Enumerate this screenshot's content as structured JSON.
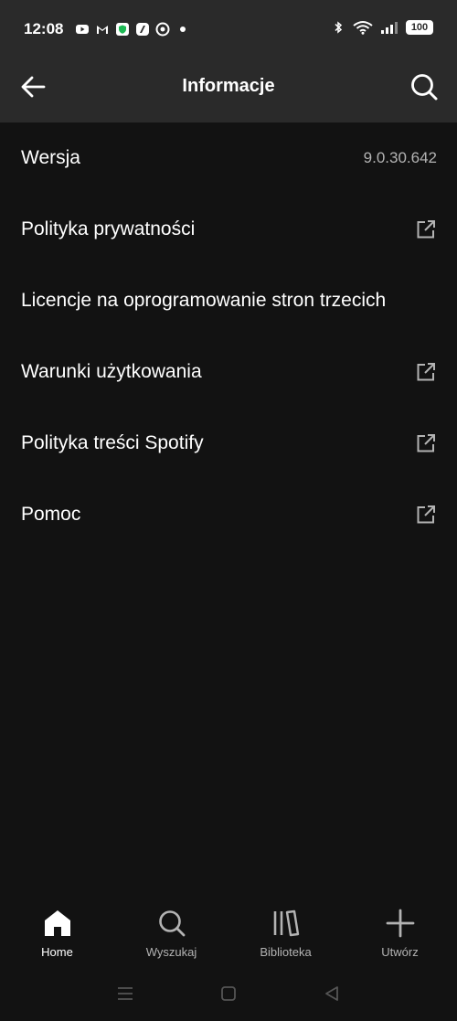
{
  "status_bar": {
    "time": "12:08",
    "battery": "100",
    "left_icons": [
      "youtube-icon",
      "gmail-icon",
      "vpn-shield-icon",
      "app-icon",
      "chrome-icon",
      "dot-icon"
    ],
    "right_icons": [
      "bluetooth-icon",
      "wifi-icon",
      "signal-icon",
      "battery-icon"
    ]
  },
  "header": {
    "title": "Informacje",
    "back_icon": "arrow-left-icon",
    "search_icon": "search-icon"
  },
  "list": {
    "items": [
      {
        "label": "Wersja",
        "value": "9.0.30.642",
        "external": false
      },
      {
        "label": "Polityka prywatności",
        "value": "",
        "external": true
      },
      {
        "label": "Licencje na oprogramowanie stron trzecich",
        "value": "",
        "external": false
      },
      {
        "label": "Warunki użytkowania",
        "value": "",
        "external": true
      },
      {
        "label": "Polityka treści Spotify",
        "value": "",
        "external": true
      },
      {
        "label": "Pomoc",
        "value": "",
        "external": true
      }
    ]
  },
  "bottom_nav": {
    "items": [
      {
        "label": "Home",
        "icon": "home-icon",
        "active": true
      },
      {
        "label": "Wyszukaj",
        "icon": "search-icon",
        "active": false
      },
      {
        "label": "Biblioteka",
        "icon": "library-icon",
        "active": false
      },
      {
        "label": "Utwórz",
        "icon": "plus-icon",
        "active": false
      }
    ]
  },
  "system_nav": {
    "icons": [
      "menu-icon",
      "home-square-icon",
      "back-triangle-icon"
    ]
  },
  "colors": {
    "background": "#121212",
    "header": "#2a2a2a",
    "text": "#ffffff",
    "muted": "#b3b3b3"
  }
}
